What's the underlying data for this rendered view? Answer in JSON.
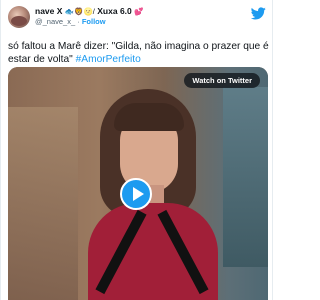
{
  "author": {
    "display_name": "nave X",
    "name_emojis": "🐟🦁🌝/",
    "name_suffix": "Xuxa 6.0",
    "name_suffix_emoji": "💕",
    "handle": "@_nave_x_",
    "separator": "·",
    "follow_label": "Follow"
  },
  "tweet": {
    "text": "só faltou a Marê dizer: \"Gilda, não imagina o prazer que é estar de volta\"",
    "hashtag": "#AmorPerfeito"
  },
  "media": {
    "watch_label": "Watch on Twitter"
  },
  "colors": {
    "twitter_blue": "#1d9bf0",
    "text": "#0f1419",
    "secondary_text": "#536471"
  },
  "icons": {
    "brand": "twitter-bird-icon",
    "play": "play-icon"
  }
}
